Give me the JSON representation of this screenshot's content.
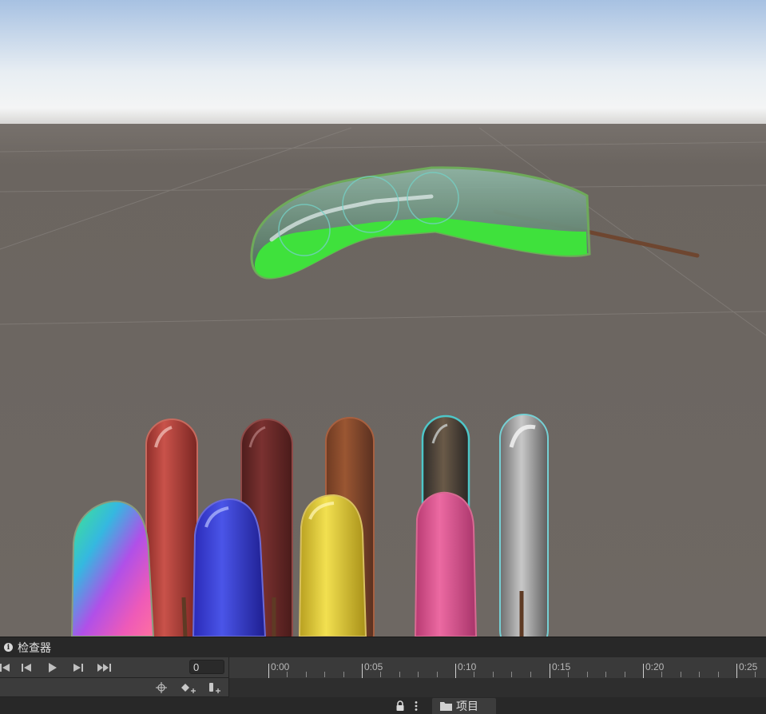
{
  "inspector": {
    "title": "检查器",
    "info_icon": "info-icon"
  },
  "animation": {
    "frame_value": "0",
    "buttons": [
      "first-key-icon",
      "prev-key-icon",
      "play-icon",
      "next-key-icon",
      "last-key-icon"
    ],
    "tools": [
      "crosshair-icon",
      "add-keyframe-icon",
      "add-event-icon"
    ],
    "timeline_labels": [
      "0:00",
      "0:05",
      "0:10",
      "0:15",
      "0:20",
      "0:25"
    ]
  },
  "bottom": {
    "project_tab": "项目",
    "lock_icon": "lock-icon",
    "more_icon": "more-icon",
    "folder_icon": "folder-icon"
  },
  "colors": {
    "sky_top": "#a9c3e3",
    "horizon": "#eef2f5",
    "ground": "#6d6762",
    "panel_dark": "#282828",
    "panel_mid": "#3c3c3c",
    "green_slime": "#3ee63b"
  }
}
